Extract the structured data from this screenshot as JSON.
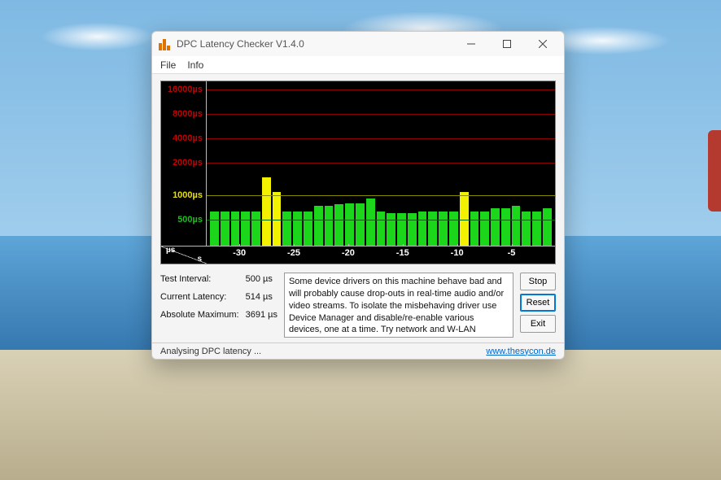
{
  "window": {
    "title": "DPC Latency Checker V1.4.0",
    "menus": {
      "file": "File",
      "info": "Info"
    }
  },
  "chart_data": {
    "type": "bar",
    "xlabel": "s",
    "ylabel": "µs",
    "y_ticks": [
      {
        "v": 16000,
        "label": "16000µs",
        "color": "red"
      },
      {
        "v": 8000,
        "label": "8000µs",
        "color": "red"
      },
      {
        "v": 4000,
        "label": "4000µs",
        "color": "red"
      },
      {
        "v": 2000,
        "label": "2000µs",
        "color": "red"
      },
      {
        "v": 1000,
        "label": "1000µs",
        "color": "ylw"
      },
      {
        "v": 500,
        "label": "500µs",
        "color": "grn"
      }
    ],
    "x_ticks": [
      "-30",
      "-25",
      "-20",
      "-15",
      "-10",
      "-5"
    ],
    "x": [
      -33,
      -32,
      -31,
      -30,
      -29,
      -28,
      -27,
      -26,
      -25,
      -24,
      -23,
      -22,
      -21,
      -20,
      -19,
      -18,
      -17,
      -16,
      -15,
      -14,
      -13,
      -12,
      -11,
      -10,
      -9,
      -8,
      -7,
      -6,
      -5,
      -4,
      -3,
      -2,
      -1
    ],
    "values": [
      640,
      640,
      640,
      640,
      640,
      1500,
      1050,
      640,
      640,
      640,
      750,
      750,
      780,
      800,
      800,
      900,
      640,
      600,
      600,
      600,
      640,
      640,
      640,
      640,
      1050,
      640,
      640,
      700,
      700,
      750,
      640,
      640,
      700
    ],
    "threshold_green": 500,
    "threshold_yellow": 1000
  },
  "stats": {
    "test_interval_label": "Test Interval:",
    "test_interval_value": "500 µs",
    "current_latency_label": "Current Latency:",
    "current_latency_value": "514 µs",
    "absolute_max_label": "Absolute Maximum:",
    "absolute_max_value": "3691 µs"
  },
  "info_text": "Some device drivers on this machine behave bad and will probably cause drop-outs in real-time audio and/or video streams. To isolate the misbehaving driver use Device Manager and disable/re-enable various devices, one at a time. Try network and W-LAN adapters, modems, internal sound devices, USB host controllers, etc.",
  "buttons": {
    "stop": "Stop",
    "reset": "Reset",
    "exit": "Exit"
  },
  "status": {
    "text": "Analysing DPC latency ...",
    "link": "www.thesycon.de"
  }
}
